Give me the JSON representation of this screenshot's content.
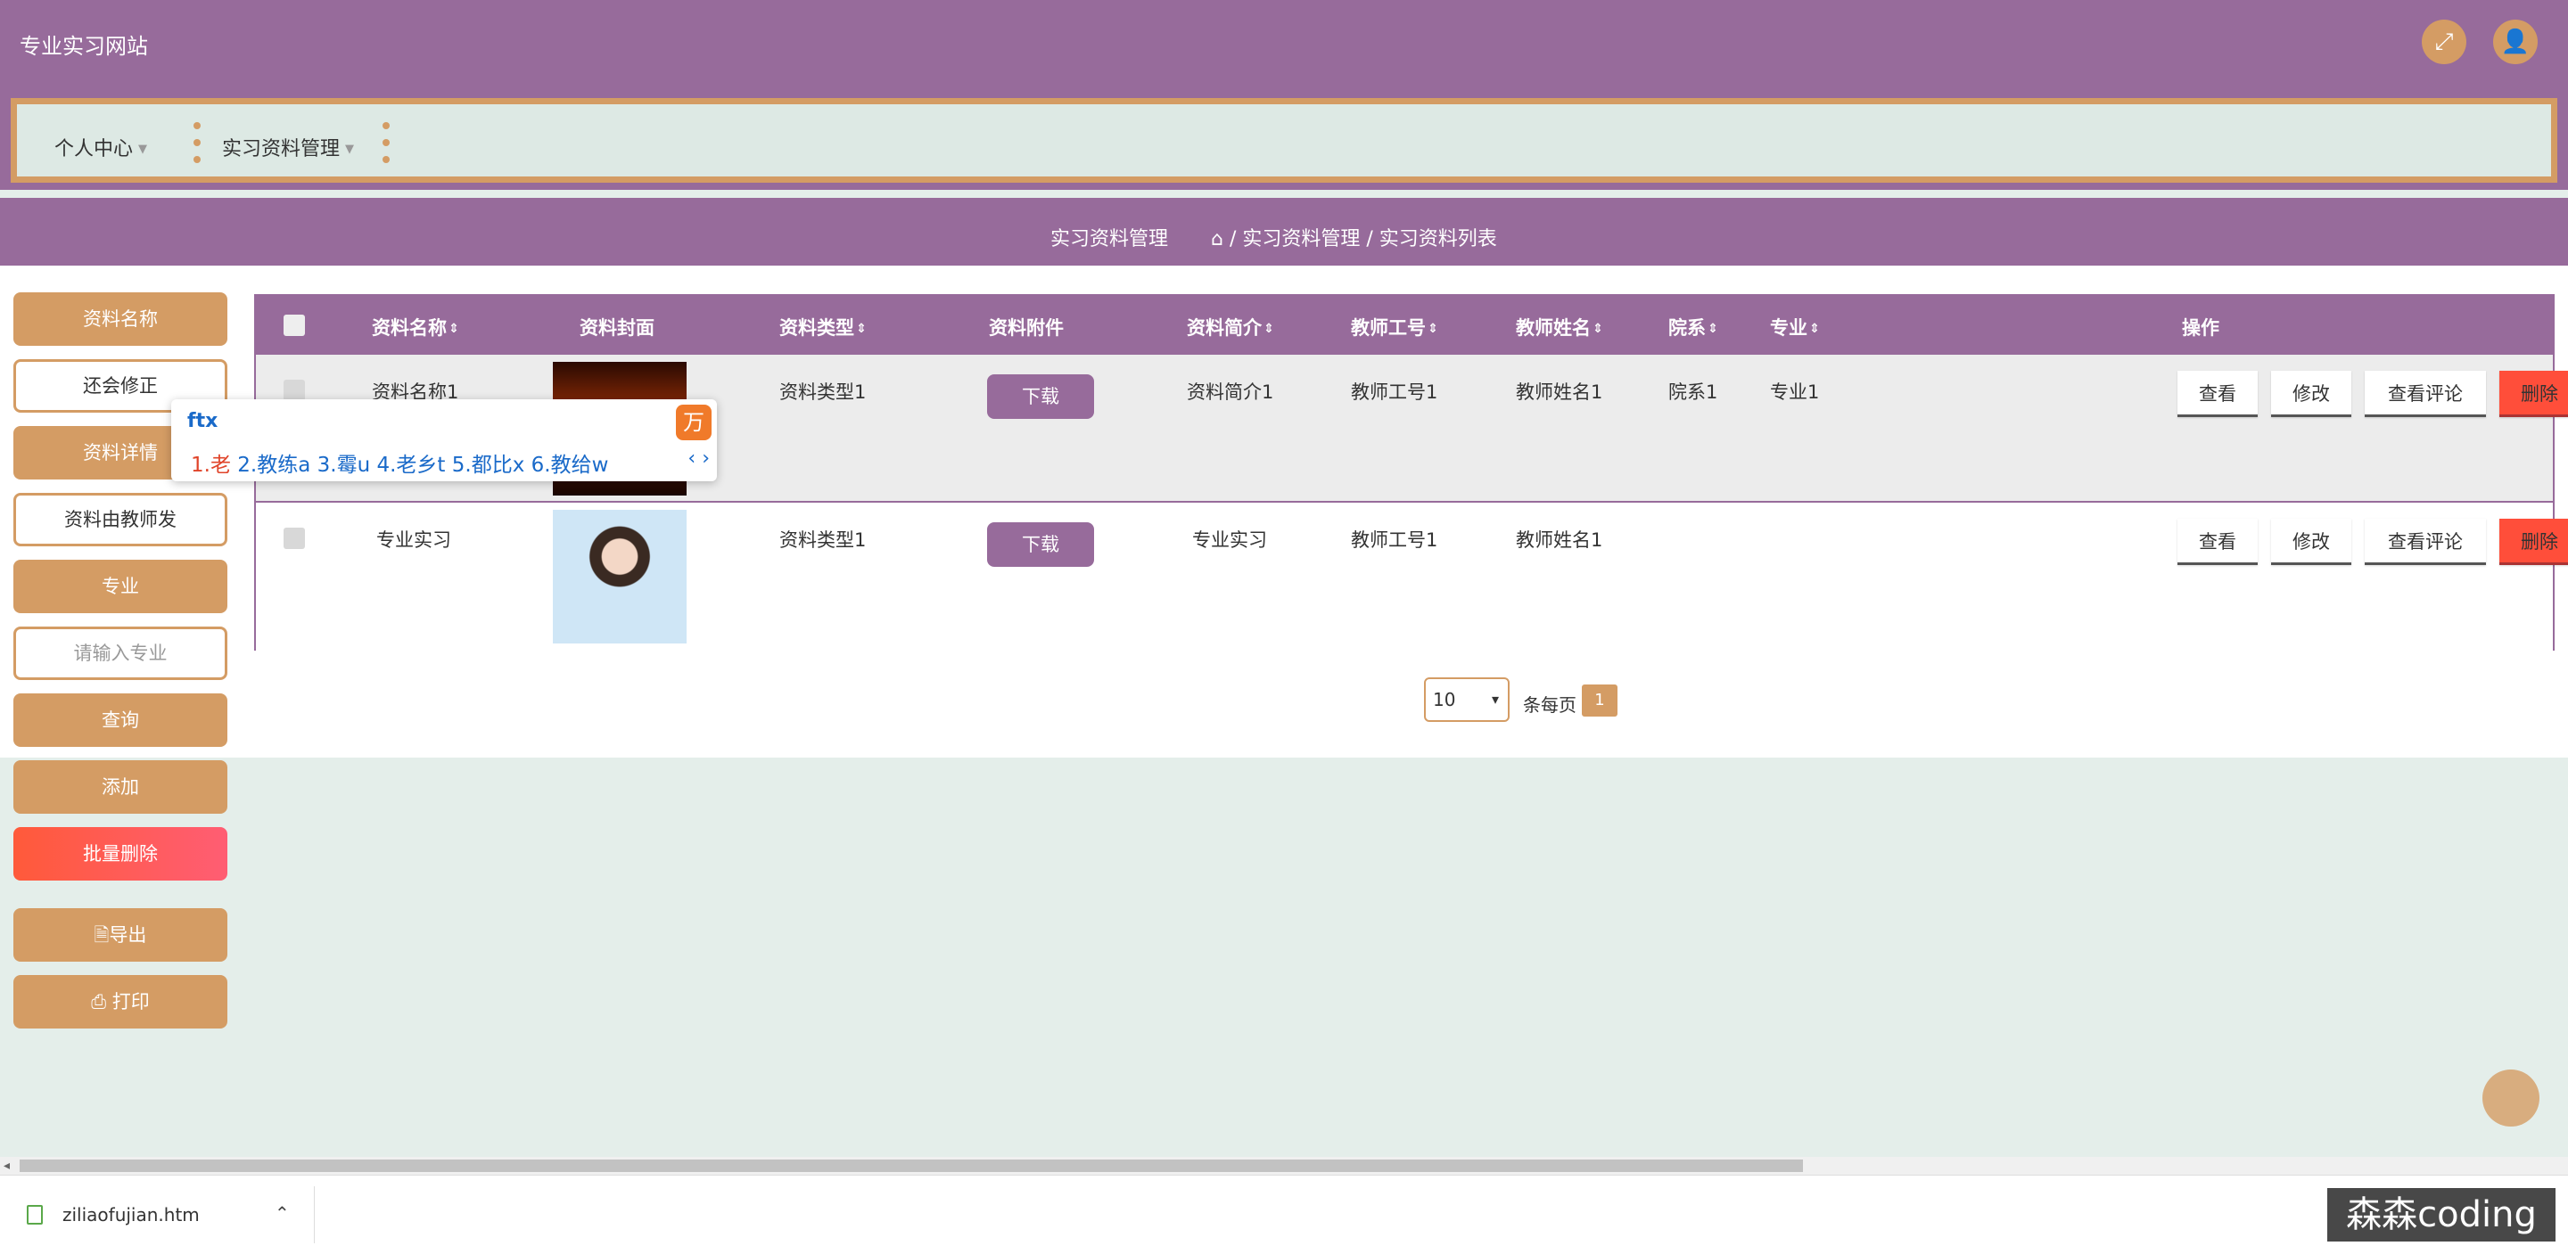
{
  "header": {
    "site_title": "专业实习网站"
  },
  "menu": {
    "items": [
      {
        "label": "个人中心"
      },
      {
        "label": "实习资料管理"
      }
    ]
  },
  "breadcrumb": {
    "title": "实习资料管理",
    "path": "/ 实习资料管理 / 实习资料列表"
  },
  "sidebar": {
    "name_label": "资料名称",
    "name_value": "还会修正",
    "detail_label": "资料详情",
    "detail_value": "资料由教师发",
    "major_label": "专业",
    "major_placeholder": "请输入专业",
    "query": "查询",
    "add": "添加",
    "batch_delete": "批量删除",
    "export": "导出",
    "print": "打印"
  },
  "table": {
    "columns": [
      "资料名称",
      "资料封面",
      "资料类型",
      "资料附件",
      "资料简介",
      "教师工号",
      "教师姓名",
      "院系",
      "专业",
      "操作"
    ],
    "rows": [
      {
        "name": "资料名称1",
        "type": "资料类型1",
        "attachment": "下载",
        "intro": "资料简介1",
        "teacher_id": "教师工号1",
        "teacher_name": "教师姓名1",
        "dept": "院系1",
        "major": "专业1"
      },
      {
        "name": "专业实习",
        "type": "资料类型1",
        "attachment": "下载",
        "intro": "专业实习",
        "teacher_id": "教师工号1",
        "teacher_name": "教师姓名1",
        "dept": "",
        "major": ""
      }
    ],
    "actions": {
      "view": "查看",
      "edit": "修改",
      "comments": "查看评论",
      "delete": "删除"
    }
  },
  "pagination": {
    "page_size": "10",
    "per_page_label": "条每页",
    "current_page": "1"
  },
  "ime": {
    "code": "ftx",
    "candidates": [
      "1.老",
      "2.教练a",
      "3.霉u",
      "4.老乡t",
      "5.都比x",
      "6.教给w"
    ]
  },
  "download_bar": {
    "filename": "ziliaofujian.htm"
  },
  "watermark": "森森coding",
  "colors": {
    "primary": "#976b9b",
    "accent": "#d49c64",
    "danger": "#ff4e3a",
    "panel": "#dde9e4"
  }
}
